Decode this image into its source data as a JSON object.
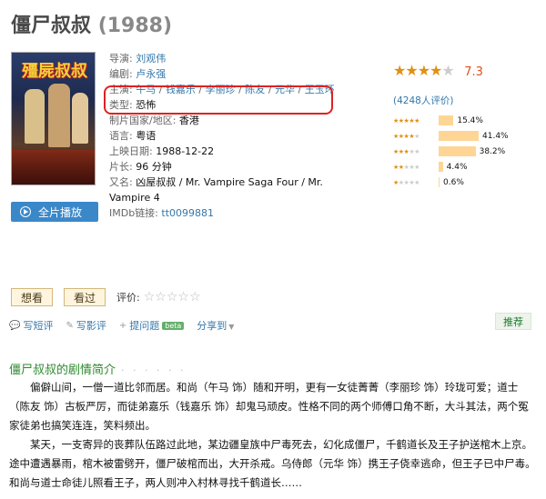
{
  "title": {
    "name": "僵尸叔叔",
    "year": "(1988)"
  },
  "info": {
    "director_label": "导演:",
    "director": "刘观伟",
    "writer_label": "编剧:",
    "writer": "卢永强",
    "cast_label": "主演:",
    "cast": [
      "午马",
      "钱嘉乐",
      "李丽珍",
      "陈友",
      "元华",
      "王玉环"
    ],
    "cast_sep": " / ",
    "genre_label": "类型:",
    "genre": "恐怖",
    "country_label": "制片国家/地区:",
    "country": "香港",
    "language_label": "语言:",
    "language": "粤语",
    "release_label": "上映日期:",
    "release": "1988-12-22",
    "runtime_label": "片长:",
    "runtime": "96 分钟",
    "aka_label": "又名:",
    "aka": "凶屋叔叔 / Mr. Vampire Saga Four / Mr. Vampire 4",
    "imdb_label": "IMDb链接:",
    "imdb": "tt0099881"
  },
  "rating": {
    "score": "7.3",
    "stars_filled": 3.5,
    "votes_text": "(4248人评价)",
    "distribution": [
      {
        "stars": 5,
        "percent": 15.4,
        "label": "15.4%"
      },
      {
        "stars": 4,
        "percent": 41.4,
        "label": "41.4%"
      },
      {
        "stars": 3,
        "percent": 38.2,
        "label": "38.2%"
      },
      {
        "stars": 2,
        "percent": 4.4,
        "label": "4.4%"
      },
      {
        "stars": 1,
        "percent": 0.6,
        "label": "0.6%"
      }
    ]
  },
  "play_button": "全片播放",
  "buttons": {
    "want": "想看",
    "seen": "看过",
    "rate_label": "评价:"
  },
  "actions": {
    "short_review": "写短评",
    "review": "写影评",
    "question": "提问题",
    "beta": "beta",
    "share": "分享到",
    "recommend": "推荐"
  },
  "summary": {
    "title": "僵尸叔叔的剧情简介",
    "dots": "· · · · · ·",
    "paragraphs": [
      "偏僻山间，一僧一道比邻而居。和尚（午马 饰）随和开明，更有一女徒菁菁（李丽珍 饰）玲珑可爱；道士（陈友 饰）古板严厉，而徒弟嘉乐（钱嘉乐 饰）却鬼马顽皮。性格不同的两个师傅口角不断，大斗其法，两个冤家徒弟也搞笑连连，笑料频出。",
      "某天，一支寄异的丧葬队伍路过此地，某边疆皇族中尸毒死去，幻化成僵尸，千鹤道长及王子护送棺木上京。途中遭遇暴雨，棺木被雷劈开，僵尸破棺而出，大开杀戒。乌侍郎（元华 饰）携王子侥幸逃命，但王子已中尸毒。和尚与道士命徒儿照看王子，两人则冲入村林寻找千鹤道长……"
    ]
  },
  "colors": {
    "link": "#3377aa",
    "star": "#e09015",
    "score": "#e05020",
    "green": "#2d8a2d",
    "play": "#3b88c9",
    "highlight": "#dd2222"
  }
}
